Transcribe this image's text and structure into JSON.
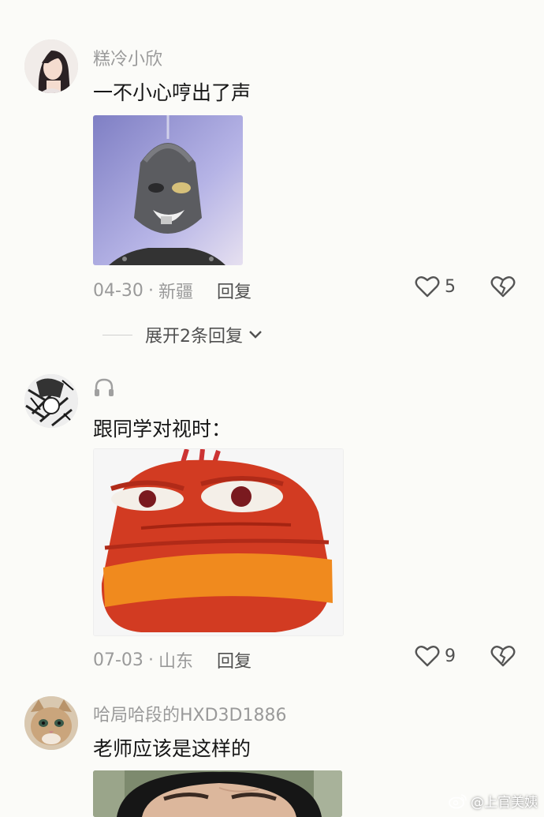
{
  "comments": [
    {
      "username": "糕冷小欣",
      "text": "一不小心哼出了声",
      "date": "04-30",
      "location": "新疆",
      "reply_label": "回复",
      "likes": "5",
      "avatar_icon": "girl-avatar",
      "meme_icon": "gray-alien-face-meme"
    },
    {
      "username": "",
      "text": "跟同学对视时：",
      "date": "07-03",
      "location": "山东",
      "reply_label": "回复",
      "likes": "9",
      "avatar_icon": "sketch-avatar",
      "meme_icon": "red-larva-side-eye-meme"
    },
    {
      "username": "哈局哈段的HXD3D1886",
      "text": "老师应该是这样的",
      "avatar_icon": "cat-avatar",
      "meme_icon": "teacher-face-meme"
    }
  ],
  "expand_replies_label": "展开2条回复",
  "watermark": "@上官美姨",
  "colors": {
    "background": "#fbfbf8",
    "muted_text": "#9a9a9a",
    "body_text": "#161616"
  }
}
